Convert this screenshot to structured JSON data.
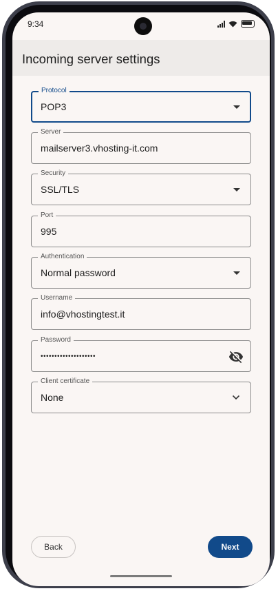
{
  "status_bar": {
    "time": "9:34"
  },
  "app_bar": {
    "title": "Incoming server settings"
  },
  "fields": {
    "protocol": {
      "label": "Protocol",
      "value": "POP3"
    },
    "server": {
      "label": "Server",
      "value": "mailserver3.vhosting-it.com"
    },
    "security": {
      "label": "Security",
      "value": "SSL/TLS"
    },
    "port": {
      "label": "Port",
      "value": "995"
    },
    "authentication": {
      "label": "Authentication",
      "value": "Normal password"
    },
    "username": {
      "label": "Username",
      "value": "info@vhostingtest.it"
    },
    "password": {
      "label": "Password",
      "value": "••••••••••••••••••••"
    },
    "client_certificate": {
      "label": "Client certificate",
      "value": "None"
    }
  },
  "buttons": {
    "back": "Back",
    "next": "Next"
  },
  "icons": {
    "dropdown": "dropdown-arrow-icon",
    "chevron": "chevron-down-icon",
    "password_toggle": "visibility-off-icon"
  },
  "colors": {
    "accent": "#114a8a",
    "background": "#faf6f4",
    "app_bar": "#eeebe9"
  }
}
